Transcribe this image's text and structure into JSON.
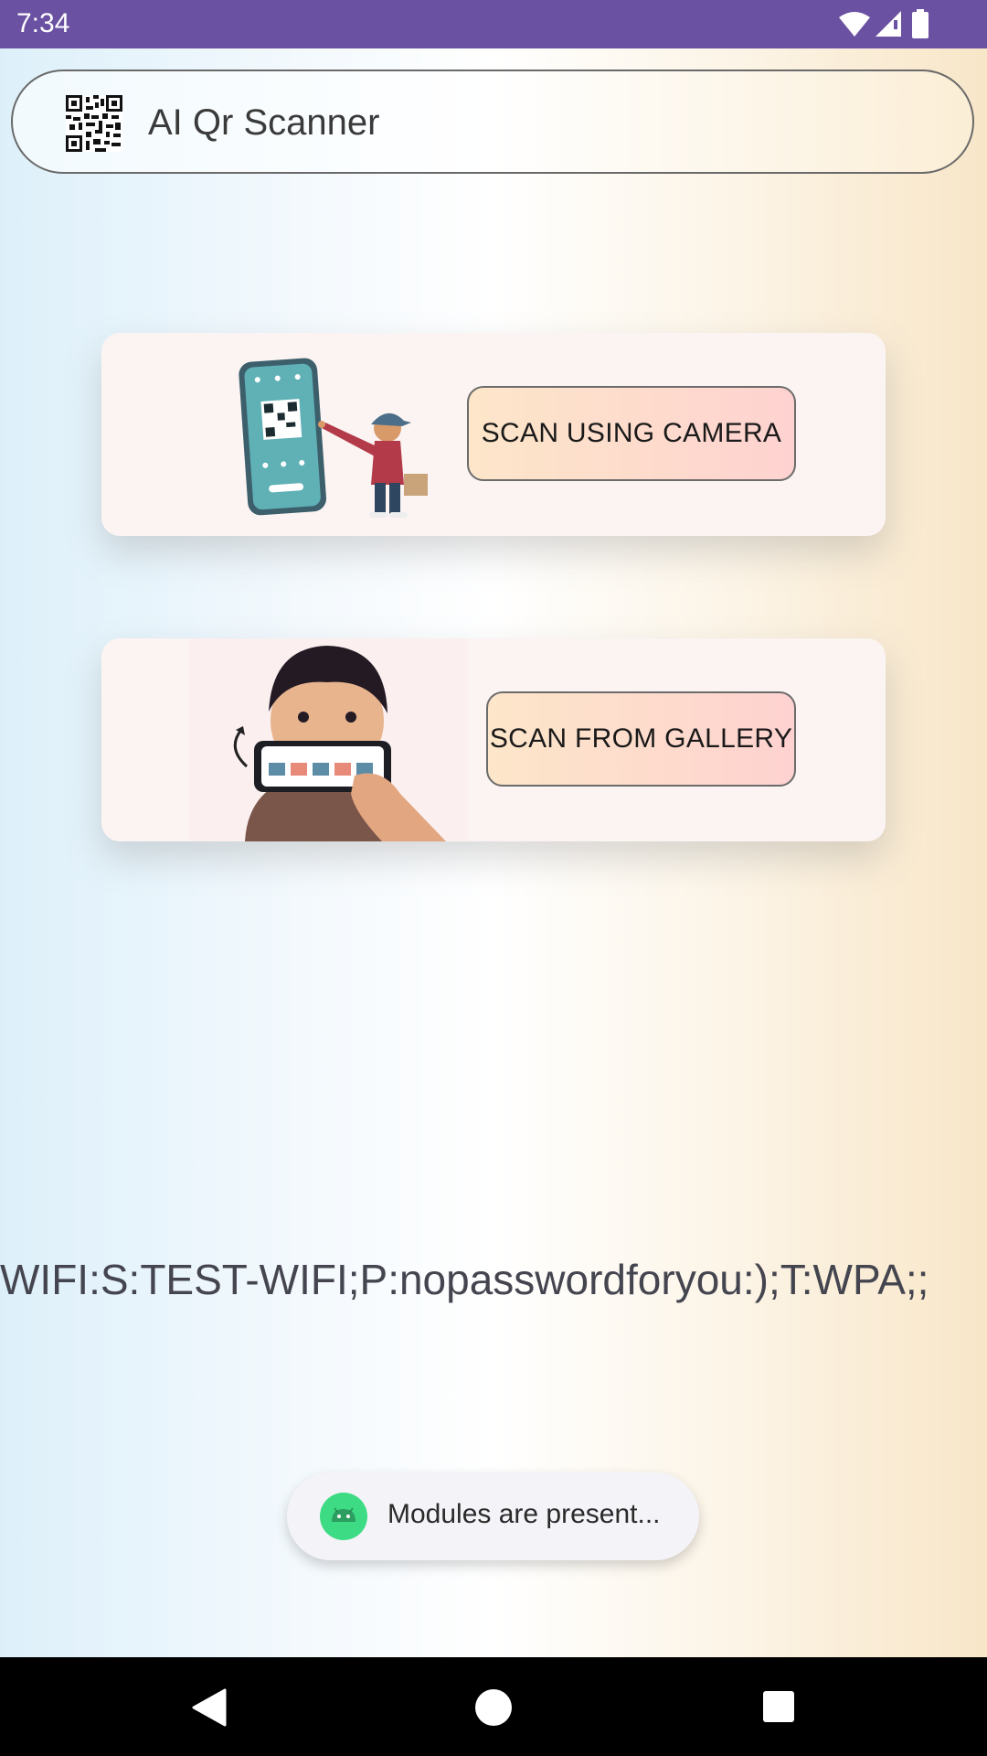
{
  "status_bar": {
    "time": "7:34",
    "icons": [
      "wifi-icon",
      "signal-icon",
      "battery-icon"
    ]
  },
  "header": {
    "title": "AI Qr Scanner",
    "logo": "qr-code-icon"
  },
  "cards": [
    {
      "button_label": "SCAN USING CAMERA",
      "illustration": "boy-pointing-at-phone-qr"
    },
    {
      "button_label": "SCAN FROM GALLERY",
      "illustration": "boy-holding-phone-gallery"
    }
  ],
  "result": {
    "text": "WIFI:S:TEST-WIFI;P:nopasswordforyou:);T:WPA;;"
  },
  "toast": {
    "message": "Modules are present...",
    "icon": "android-icon"
  },
  "nav_bar": {
    "buttons": [
      "back-icon",
      "home-icon",
      "recents-icon"
    ]
  },
  "colors": {
    "status_bar": "#6a51a2",
    "button_gradient_start": "#fde6c9",
    "button_gradient_end": "#fed2d0",
    "card_background": "#fbf4f2"
  }
}
